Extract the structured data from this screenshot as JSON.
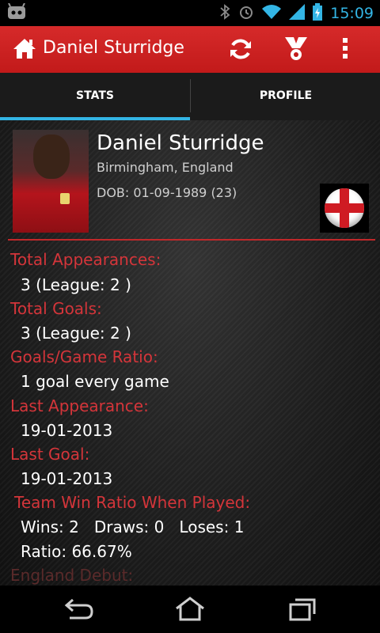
{
  "status_bar": {
    "time": "15:09"
  },
  "action_bar": {
    "title": "Daniel Sturridge"
  },
  "tabs": [
    {
      "label": "STATS"
    },
    {
      "label": "PROFILE"
    }
  ],
  "player": {
    "name": "Daniel Sturridge",
    "birthplace": "Birmingham, England",
    "dob": "DOB: 01-09-1989 (23)"
  },
  "stats": {
    "total_appearances_label": "Total Appearances:",
    "total_appearances_value": "3 (League: 2 )",
    "total_goals_label": "Total Goals:",
    "total_goals_value": "3 (League: 2 )",
    "ratio_label": "Goals/Game Ratio:",
    "ratio_value": "1 goal every game",
    "last_appearance_label": "Last Appearance:",
    "last_appearance_value": "19-01-2013",
    "last_goal_label": "Last Goal:",
    "last_goal_value": "19-01-2013",
    "win_ratio_label": "Team Win Ratio When Played:",
    "win_ratio_record": "Wins: 2   Draws: 0   Loses: 1",
    "win_ratio_value": "Ratio: 66.67%",
    "england_debut_label": "England Debut:"
  },
  "colors": {
    "accent_red": "#c21a1a",
    "tab_indicator": "#33b5e5",
    "label_red": "#d4353a"
  }
}
